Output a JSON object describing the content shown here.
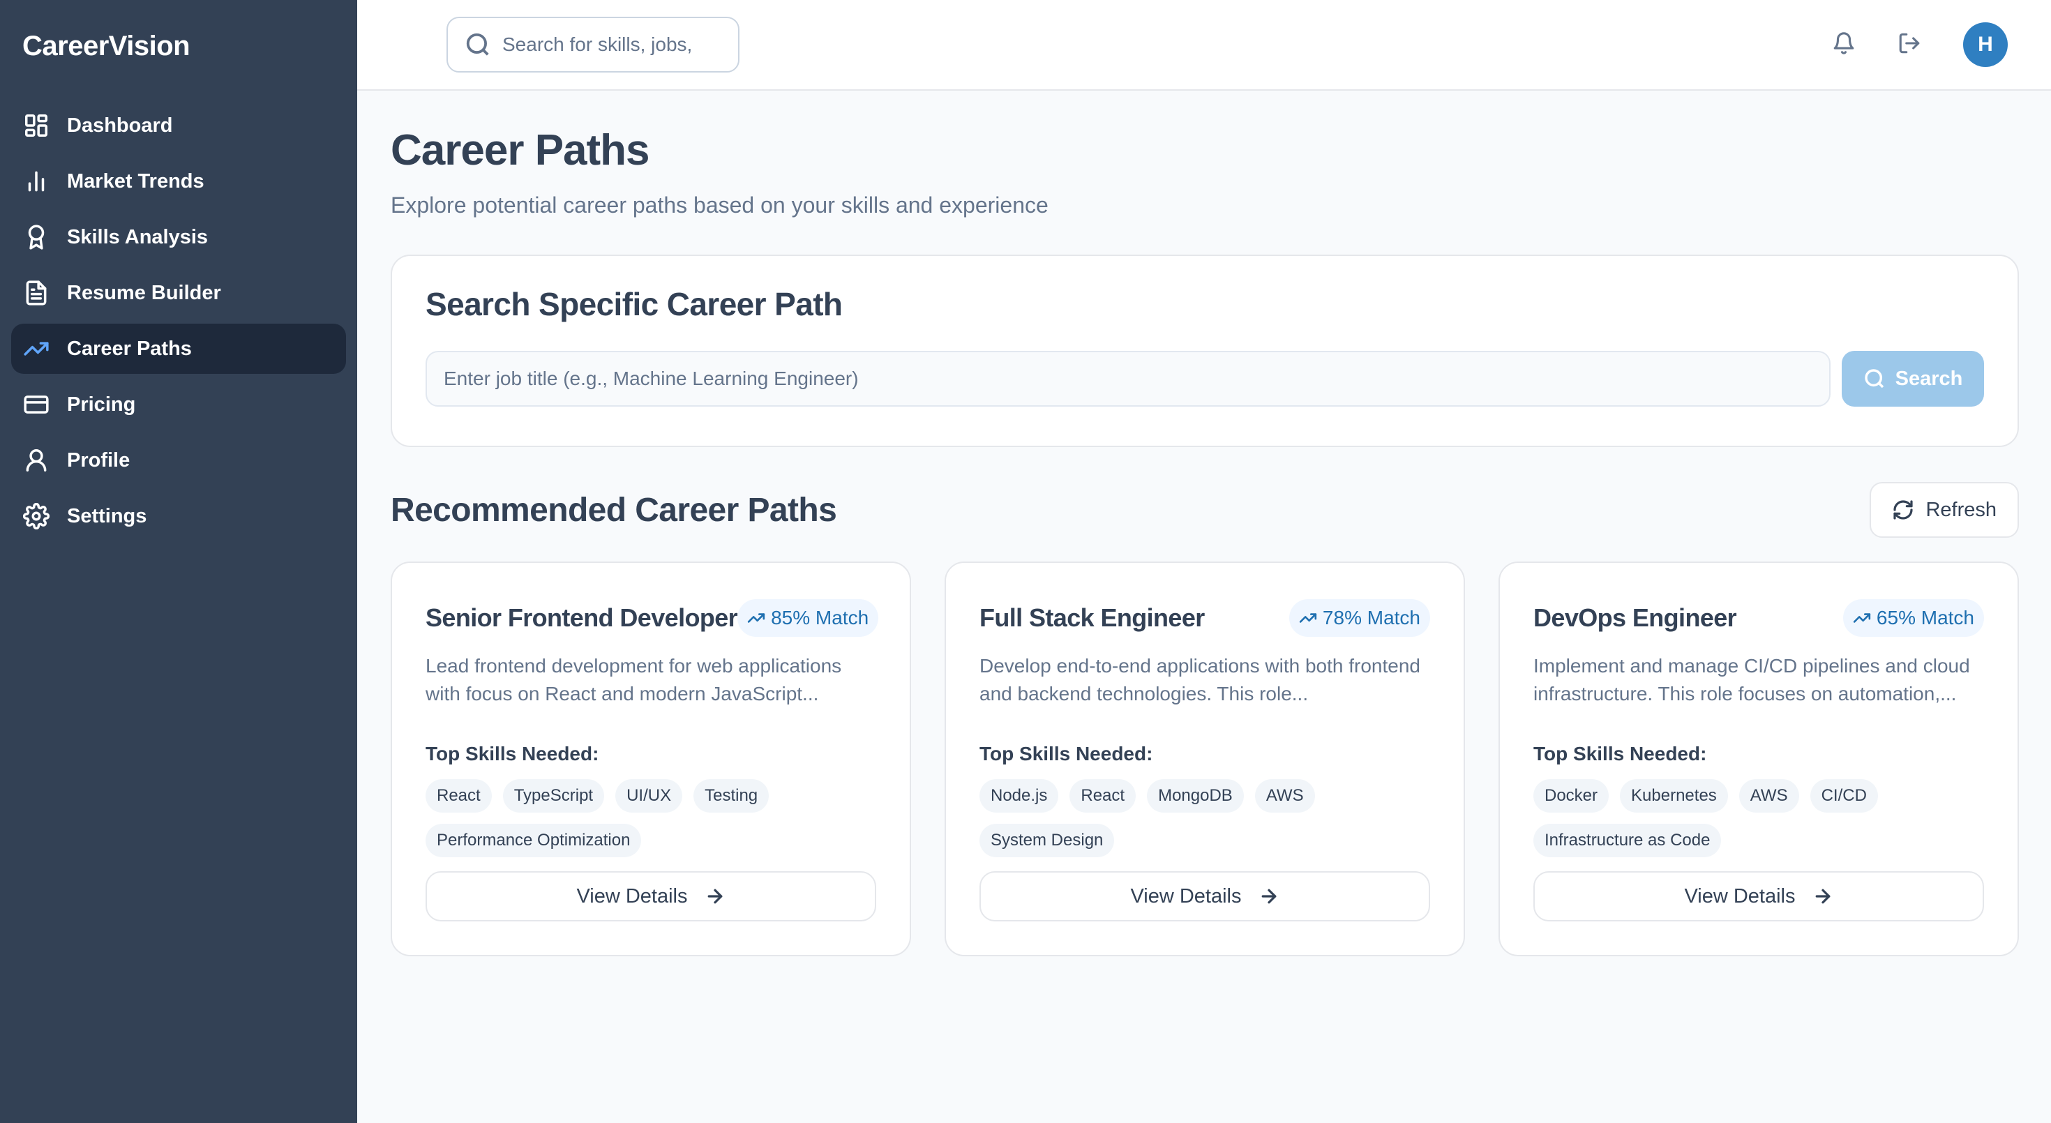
{
  "app": {
    "brand": "CareerVision"
  },
  "sidebar": {
    "items": [
      {
        "label": "Dashboard",
        "icon": "dashboard-icon",
        "active": false
      },
      {
        "label": "Market Trends",
        "icon": "bar-chart-icon",
        "active": false
      },
      {
        "label": "Skills Analysis",
        "icon": "award-icon",
        "active": false
      },
      {
        "label": "Resume Builder",
        "icon": "document-icon",
        "active": false
      },
      {
        "label": "Career Paths",
        "icon": "trending-up-icon",
        "active": true
      },
      {
        "label": "Pricing",
        "icon": "credit-card-icon",
        "active": false
      },
      {
        "label": "Profile",
        "icon": "user-icon",
        "active": false
      },
      {
        "label": "Settings",
        "icon": "gear-icon",
        "active": false
      }
    ]
  },
  "topbar": {
    "search_placeholder": "Search for skills, jobs,",
    "avatar_initial": "H"
  },
  "page": {
    "title": "Career Paths",
    "subtitle": "Explore potential career paths based on your skills and experience"
  },
  "search_card": {
    "title": "Search Specific Career Path",
    "placeholder": "Enter job title (e.g., Machine Learning Engineer)",
    "button_label": "Search"
  },
  "recommended": {
    "title": "Recommended Career Paths",
    "refresh_label": "Refresh",
    "skills_label": "Top Skills Needed:",
    "view_details_label": "View Details",
    "cards": [
      {
        "title": "Senior Frontend Developer",
        "match": "85% Match",
        "description": "Lead frontend development for web applications with focus on React and modern JavaScript...",
        "skills": [
          "React",
          "TypeScript",
          "UI/UX",
          "Testing",
          "Performance Optimization"
        ]
      },
      {
        "title": "Full Stack Engineer",
        "match": "78% Match",
        "description": "Develop end-to-end applications with both frontend and backend technologies. This role...",
        "skills": [
          "Node.js",
          "React",
          "MongoDB",
          "AWS",
          "System Design"
        ]
      },
      {
        "title": "DevOps Engineer",
        "match": "65% Match",
        "description": "Implement and manage CI/CD pipelines and cloud infrastructure. This role focuses on automation,...",
        "skills": [
          "Docker",
          "Kubernetes",
          "AWS",
          "CI/CD",
          "Infrastructure as Code"
        ]
      }
    ]
  },
  "colors": {
    "sidebar_bg": "#334155",
    "sidebar_active_bg": "#1e293b",
    "accent_blue": "#2f7fc1",
    "search_button_bg": "#9cc8ea",
    "match_badge_bg": "#eff6ff"
  }
}
